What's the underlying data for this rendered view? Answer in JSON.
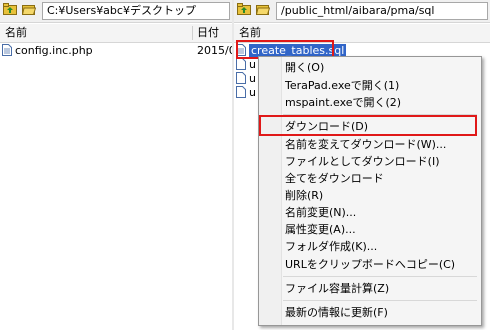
{
  "left_pane": {
    "path": "C:¥Users¥abc¥デスクトップ",
    "columns": {
      "name": "名前",
      "date": "日付"
    },
    "files": [
      {
        "name": "config.inc.php",
        "date": "2015/0"
      }
    ]
  },
  "right_pane": {
    "path": "/public_html/aibara/pma/sql",
    "columns": {
      "name": "名前"
    },
    "files": [
      {
        "name": "create_tables.sql",
        "selected": true
      },
      {
        "name": "u"
      },
      {
        "name": "u"
      },
      {
        "name": "u"
      }
    ]
  },
  "context_menu": {
    "items": [
      {
        "label": "開く(O)"
      },
      {
        "label": "TeraPad.exeで開く(1)"
      },
      {
        "label": "mspaint.exeで開く(2)"
      },
      {
        "label": "ダウンロード(D)",
        "highlighted": true
      },
      {
        "label": "名前を変えてダウンロード(W)..."
      },
      {
        "label": "ファイルとしてダウンロード(I)"
      },
      {
        "label": "全てをダウンロード"
      },
      {
        "label": "削除(R)"
      },
      {
        "label": "名前変更(N)..."
      },
      {
        "label": "属性変更(A)..."
      },
      {
        "label": "フォルダ作成(K)..."
      },
      {
        "label": "URLをクリップボードへコピー(C)"
      },
      {
        "label": "ファイル容量計算(Z)"
      },
      {
        "label": "最新の情報に更新(F)"
      }
    ]
  },
  "colors": {
    "highlight_border": "#e01818",
    "selection": "#3165c8",
    "folder_yellow": "#e8c23a"
  },
  "icons": [
    "folder-up-icon",
    "open-folder-icon",
    "file-icon"
  ]
}
